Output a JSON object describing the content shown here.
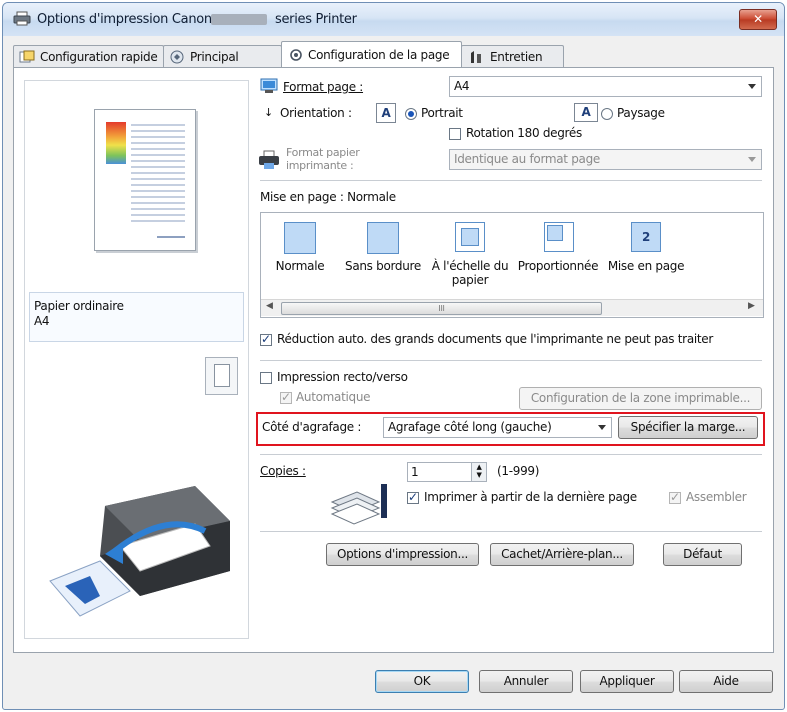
{
  "window": {
    "title_part1": "Options d'impression Canon",
    "title_part2": "series Printer",
    "close_glyph": "✕"
  },
  "tabs": [
    {
      "label": "Configuration rapide"
    },
    {
      "label": "Principal"
    },
    {
      "label": "Configuration de la page",
      "active": true
    },
    {
      "label": "Entretien"
    }
  ],
  "preview": {
    "media_type": "Papier ordinaire",
    "paper_size": "A4"
  },
  "page_size": {
    "label": "Format page :",
    "value": "A4"
  },
  "orientation": {
    "label": "Orientation :",
    "portrait": "Portrait",
    "landscape": "Paysage",
    "selected": "Portrait",
    "rotate_label": "Rotation 180 degrés",
    "rotate_checked": false
  },
  "printer_paper": {
    "label_line1": "Format papier",
    "label_line2": "imprimante :",
    "value": "Identique au format page"
  },
  "layout": {
    "label": "Mise en page : Normale",
    "items": [
      {
        "label": "Normale"
      },
      {
        "label": "Sans bordure"
      },
      {
        "label_line1": "À l'échelle du",
        "label_line2": "papier"
      },
      {
        "label": "Proportionnée"
      },
      {
        "label": "Mise en page",
        "icon_number": "2"
      }
    ],
    "scroll_glyph": "III"
  },
  "auto_reduce": {
    "label": "Réduction auto. des grands documents que l'imprimante ne peut pas traiter",
    "checked": true
  },
  "duplex": {
    "label": "Impression recto/verso",
    "checked": false,
    "auto_label": "Automatique",
    "auto_checked": true,
    "print_area_button": "Configuration de la zone imprimable..."
  },
  "stapling": {
    "label": "Côté d'agrafage :",
    "value": "Agrafage côté long (gauche)",
    "margin_button": "Spécifier la marge...",
    "highlight_color": "#e0141e"
  },
  "copies": {
    "label": "Copies :",
    "value": "1",
    "range": "(1-999)",
    "last_page_label": "Imprimer à partir de la dernière page",
    "last_page_checked": true,
    "collate_label": "Assembler",
    "collate_checked": true
  },
  "bottom_buttons": {
    "print_options": "Options d'impression...",
    "stamp": "Cachet/Arrière-plan...",
    "defaults": "Défaut"
  },
  "dialog_buttons": {
    "ok": "OK",
    "cancel": "Annuler",
    "apply": "Appliquer",
    "help": "Aide"
  }
}
